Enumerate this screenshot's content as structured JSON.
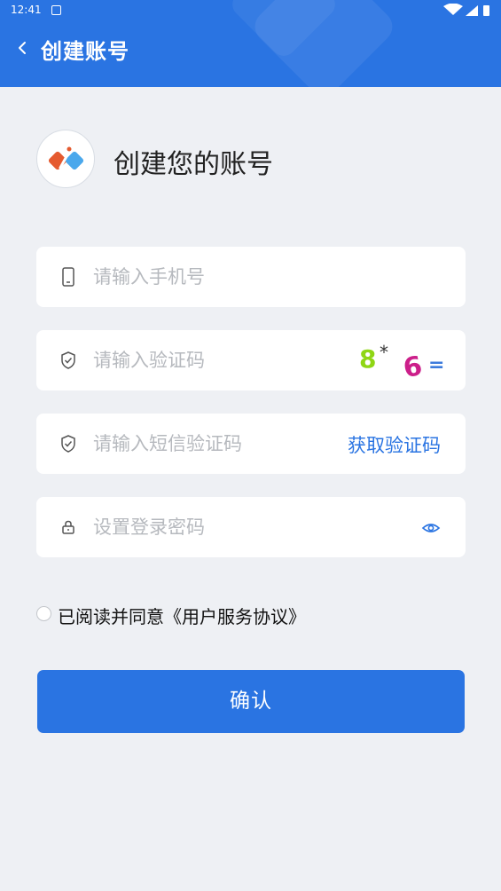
{
  "status_bar": {
    "time": "12:41"
  },
  "nav": {
    "title": "创建账号"
  },
  "welcome": {
    "title": "创建您的账号"
  },
  "form": {
    "phone": {
      "placeholder": "请输入手机号",
      "value": ""
    },
    "captcha": {
      "placeholder": "请输入验证码",
      "value": "",
      "code": "8*6="
    },
    "sms": {
      "placeholder": "请输入短信验证码",
      "value": "",
      "button_label": "获取验证码"
    },
    "password": {
      "placeholder": "设置登录密码",
      "value": ""
    }
  },
  "agreement": {
    "checked": false,
    "text": "已阅读并同意《用户服务协议》"
  },
  "confirm": {
    "label": "确认"
  },
  "colors": {
    "primary": "#2a74e2",
    "background": "#eef0f4",
    "placeholder": "#b6b9be"
  },
  "icons": {
    "back": "chevron-left-icon",
    "phone": "phone-icon",
    "captcha": "shield-check-icon",
    "sms": "shield-check-icon",
    "password": "lock-icon",
    "eye": "eye-icon"
  }
}
